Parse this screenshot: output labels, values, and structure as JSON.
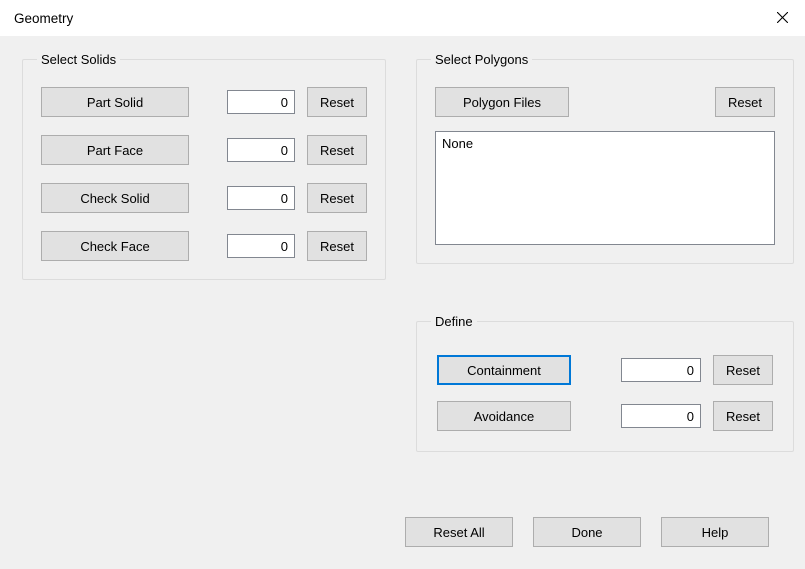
{
  "window": {
    "title": "Geometry"
  },
  "solids": {
    "legend": "Select Solids",
    "rows": [
      {
        "btn": "Part Solid",
        "value": "0",
        "reset": "Reset"
      },
      {
        "btn": "Part Face",
        "value": "0",
        "reset": "Reset"
      },
      {
        "btn": "Check Solid",
        "value": "0",
        "reset": "Reset"
      },
      {
        "btn": "Check Face",
        "value": "0",
        "reset": "Reset"
      }
    ]
  },
  "polygons": {
    "legend": "Select Polygons",
    "files_btn": "Polygon Files",
    "reset": "Reset",
    "list_content": "None"
  },
  "define": {
    "legend": "Define",
    "rows": [
      {
        "btn": "Containment",
        "value": "0",
        "reset": "Reset",
        "selected": true
      },
      {
        "btn": "Avoidance",
        "value": "0",
        "reset": "Reset",
        "selected": false
      }
    ]
  },
  "bottom": {
    "reset_all": "Reset All",
    "done": "Done",
    "help": "Help"
  }
}
